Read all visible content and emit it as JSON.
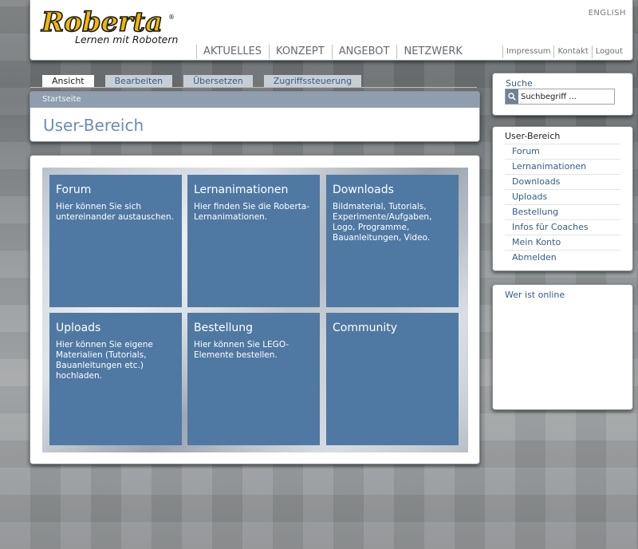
{
  "header": {
    "logo_text": "Roberta",
    "logo_tagline": "Lernen mit Robotern",
    "language_link": "ENGLISH",
    "main_nav": [
      "AKTUELLES",
      "KONZEPT",
      "ANGEBOT",
      "NETZWERK"
    ],
    "meta_nav": [
      "Impressum",
      "Kontakt",
      "Logout"
    ]
  },
  "tabs": [
    {
      "label": "Ansicht",
      "active": true
    },
    {
      "label": "Bearbeiten",
      "active": false
    },
    {
      "label": "Übersetzen",
      "active": false
    },
    {
      "label": "Zugriffssteuerung",
      "active": false
    }
  ],
  "breadcrumb": "Startseite",
  "page_title": "User-Bereich",
  "tiles": [
    {
      "title": "Forum",
      "description": "Hier können Sie sich untereinander austauschen."
    },
    {
      "title": "Lernanimationen",
      "description": "Hier finden Sie die Roberta-Lernanimationen."
    },
    {
      "title": "Downloads",
      "description": "Bildmaterial, Tutorials, Experimente/Aufgaben, Logo, Programme, Bauanleitungen, Video."
    },
    {
      "title": "Uploads",
      "description": "Hier können Sie eigene Materialien (Tutorials, Bauanleitungen etc.) hochladen."
    },
    {
      "title": "Bestellung",
      "description": "Hier können Sie LEGO-Elemente bestellen."
    },
    {
      "title": "Community",
      "description": ""
    }
  ],
  "sidebar": {
    "search_label": "Suche",
    "search_placeholder": "Suchbegriff ...",
    "user_area_heading": "User-Bereich",
    "user_menu": [
      "Forum",
      "Lernanimationen",
      "Downloads",
      "Uploads",
      "Bestellung",
      "Infos für Coaches",
      "Mein Konto",
      "Abmelden"
    ],
    "who_online_heading": "Wer ist online"
  },
  "colors": {
    "tile_blue": "#4f79a3",
    "link_blue": "#355d86",
    "title_blue": "#6a8eb5",
    "breadcrumb_bar": "#8f9eae",
    "logo_yellow": "#f2b705"
  }
}
